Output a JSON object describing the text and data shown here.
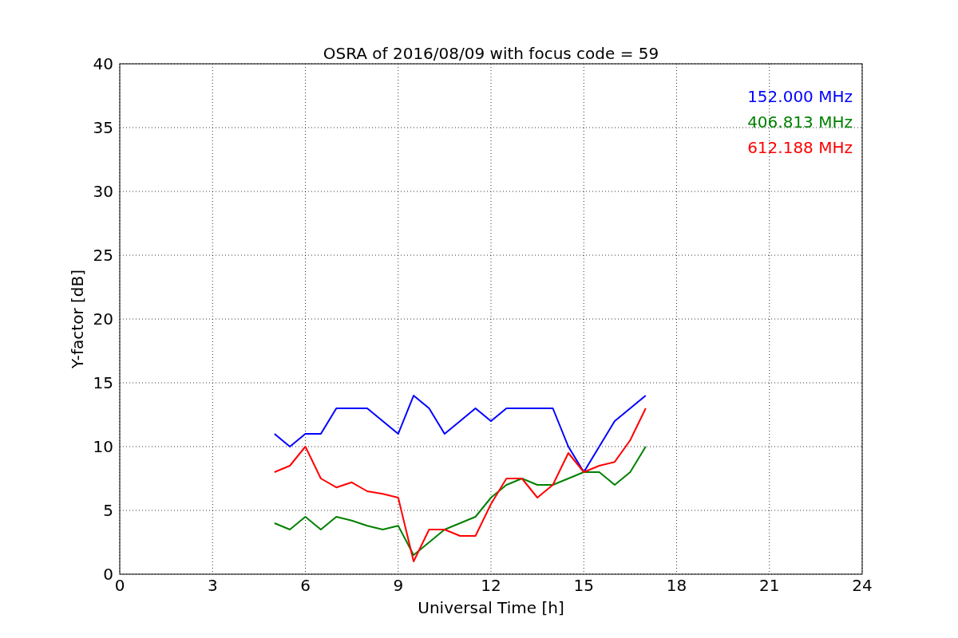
{
  "chart_data": {
    "type": "line",
    "title": "OSRA of 2016/08/09 with focus code = 59",
    "xlabel": "Universal Time [h]",
    "ylabel": "Y-factor [dB]",
    "grid": true,
    "xlim": [
      0,
      24
    ],
    "ylim": [
      0,
      40
    ],
    "xticks": [
      0,
      3,
      6,
      9,
      12,
      15,
      18,
      21,
      24
    ],
    "yticks": [
      0,
      5,
      10,
      15,
      20,
      25,
      30,
      35,
      40
    ],
    "x": [
      5,
      5.5,
      6,
      6.5,
      7,
      7.5,
      8,
      8.5,
      9,
      9.5,
      10,
      10.5,
      11,
      11.5,
      12,
      12.5,
      13,
      13.5,
      14,
      14.5,
      15,
      15.5,
      16,
      16.5,
      17
    ],
    "series": [
      {
        "name": "152.000 MHz",
        "color": "#0000ff",
        "values": [
          11,
          10,
          11,
          11,
          13,
          13,
          13,
          12,
          11,
          14,
          13,
          11,
          12,
          13,
          12,
          13,
          13,
          13,
          13,
          10,
          8,
          10,
          12,
          13,
          14
        ]
      },
      {
        "name": "406.813 MHz",
        "color": "#008000",
        "values": [
          4,
          3.5,
          4.5,
          3.5,
          4.5,
          4.2,
          3.8,
          3.5,
          3.8,
          1.5,
          2.5,
          3.5,
          4,
          4.5,
          6,
          7,
          7.5,
          7,
          7,
          7.5,
          8,
          8,
          7,
          8,
          10
        ]
      },
      {
        "name": "612.188 MHz",
        "color": "#ff0000",
        "values": [
          8,
          8.5,
          10,
          7.5,
          6.8,
          7.2,
          6.5,
          6.3,
          6,
          1,
          3.5,
          3.5,
          3,
          3,
          5.5,
          7.5,
          7.5,
          6,
          7,
          9.5,
          8,
          8.5,
          8.8,
          10.5,
          13
        ]
      }
    ]
  }
}
